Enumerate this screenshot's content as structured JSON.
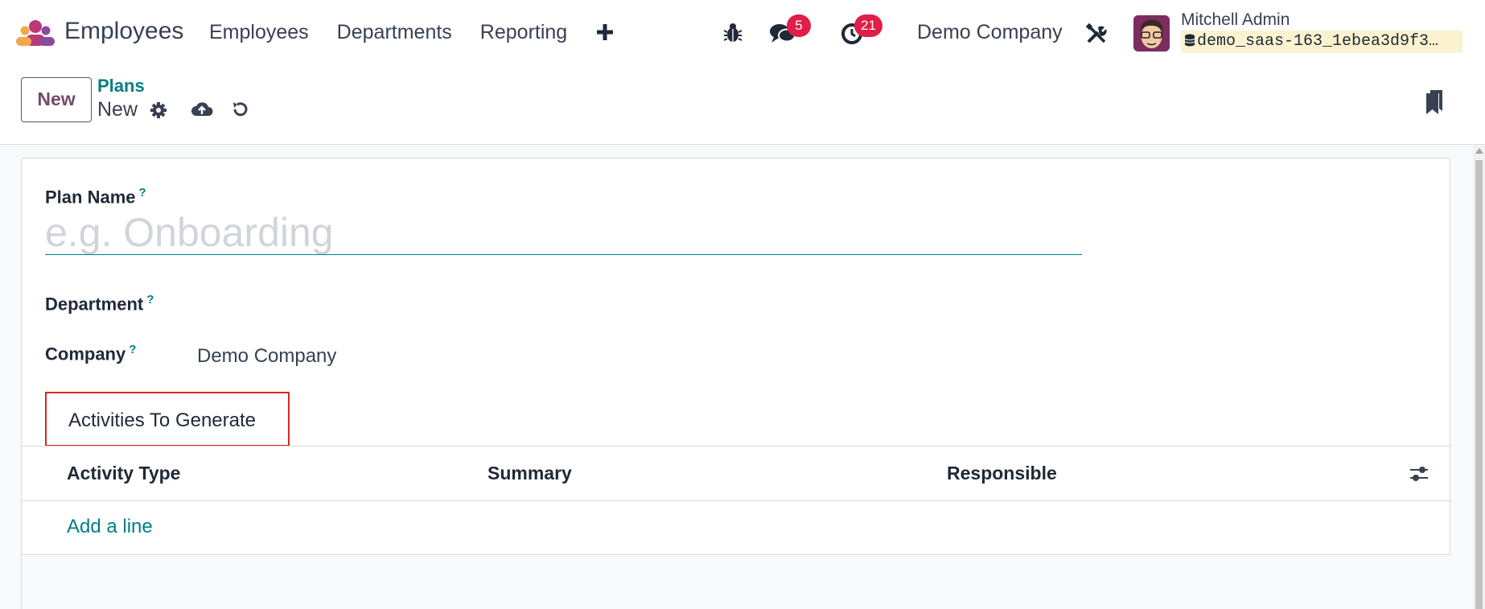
{
  "navbar": {
    "app_name": "Employees",
    "menu": [
      "Employees",
      "Departments",
      "Reporting"
    ],
    "plus_icon": "plus-icon",
    "bug_icon": "bug-icon",
    "messages_badge": "5",
    "activities_badge": "21",
    "company": "Demo Company",
    "tools_icon": "tools-icon",
    "user_name": "Mitchell Admin",
    "database": "demo_saas-163_1ebea3d9f3…"
  },
  "control_panel": {
    "new_button": "New",
    "breadcrumb_parent": "Plans",
    "breadcrumb_current": "New"
  },
  "form": {
    "plan_name_label": "Plan Name",
    "plan_name_placeholder": "e.g. Onboarding",
    "plan_name_value": "",
    "help_mark": "?",
    "department_label": "Department",
    "company_label": "Company",
    "company_value": "Demo Company",
    "tab_label": "Activities To Generate",
    "columns": [
      "Activity Type",
      "Summary",
      "Responsible"
    ],
    "add_line": "Add a line"
  },
  "colors": {
    "accent": "#017e84",
    "brand": "#714b67",
    "badge": "#e11d48",
    "highlight_border": "#dc2626"
  }
}
